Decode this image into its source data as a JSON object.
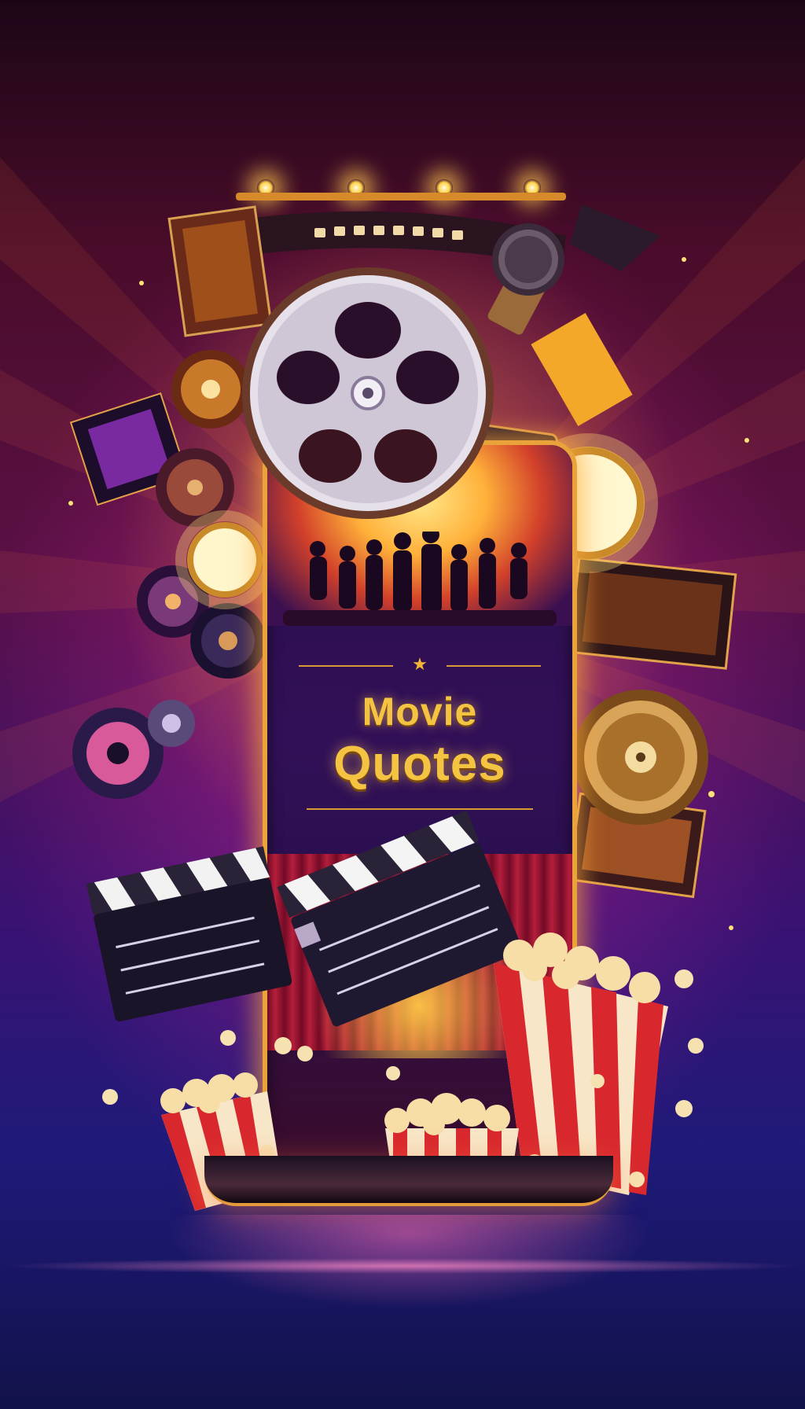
{
  "poster": {
    "title_line1": "Movie",
    "title_line2": "Quotes"
  },
  "colors": {
    "title_gold": "#f4c341",
    "frame_gold": "#e9a33a",
    "background_top": "#1c0616",
    "background_mid": "#5a1046",
    "background_bottom": "#12124a",
    "popcorn_red": "#d8282e",
    "popcorn_white": "#f7e7c8"
  },
  "icons": [
    "film-reel-icon",
    "microphone-icon",
    "clapperboard-icon",
    "popcorn-bucket-icon",
    "spotlight-icon",
    "film-strip-icon",
    "camera-icon",
    "audience-silhouette"
  ]
}
